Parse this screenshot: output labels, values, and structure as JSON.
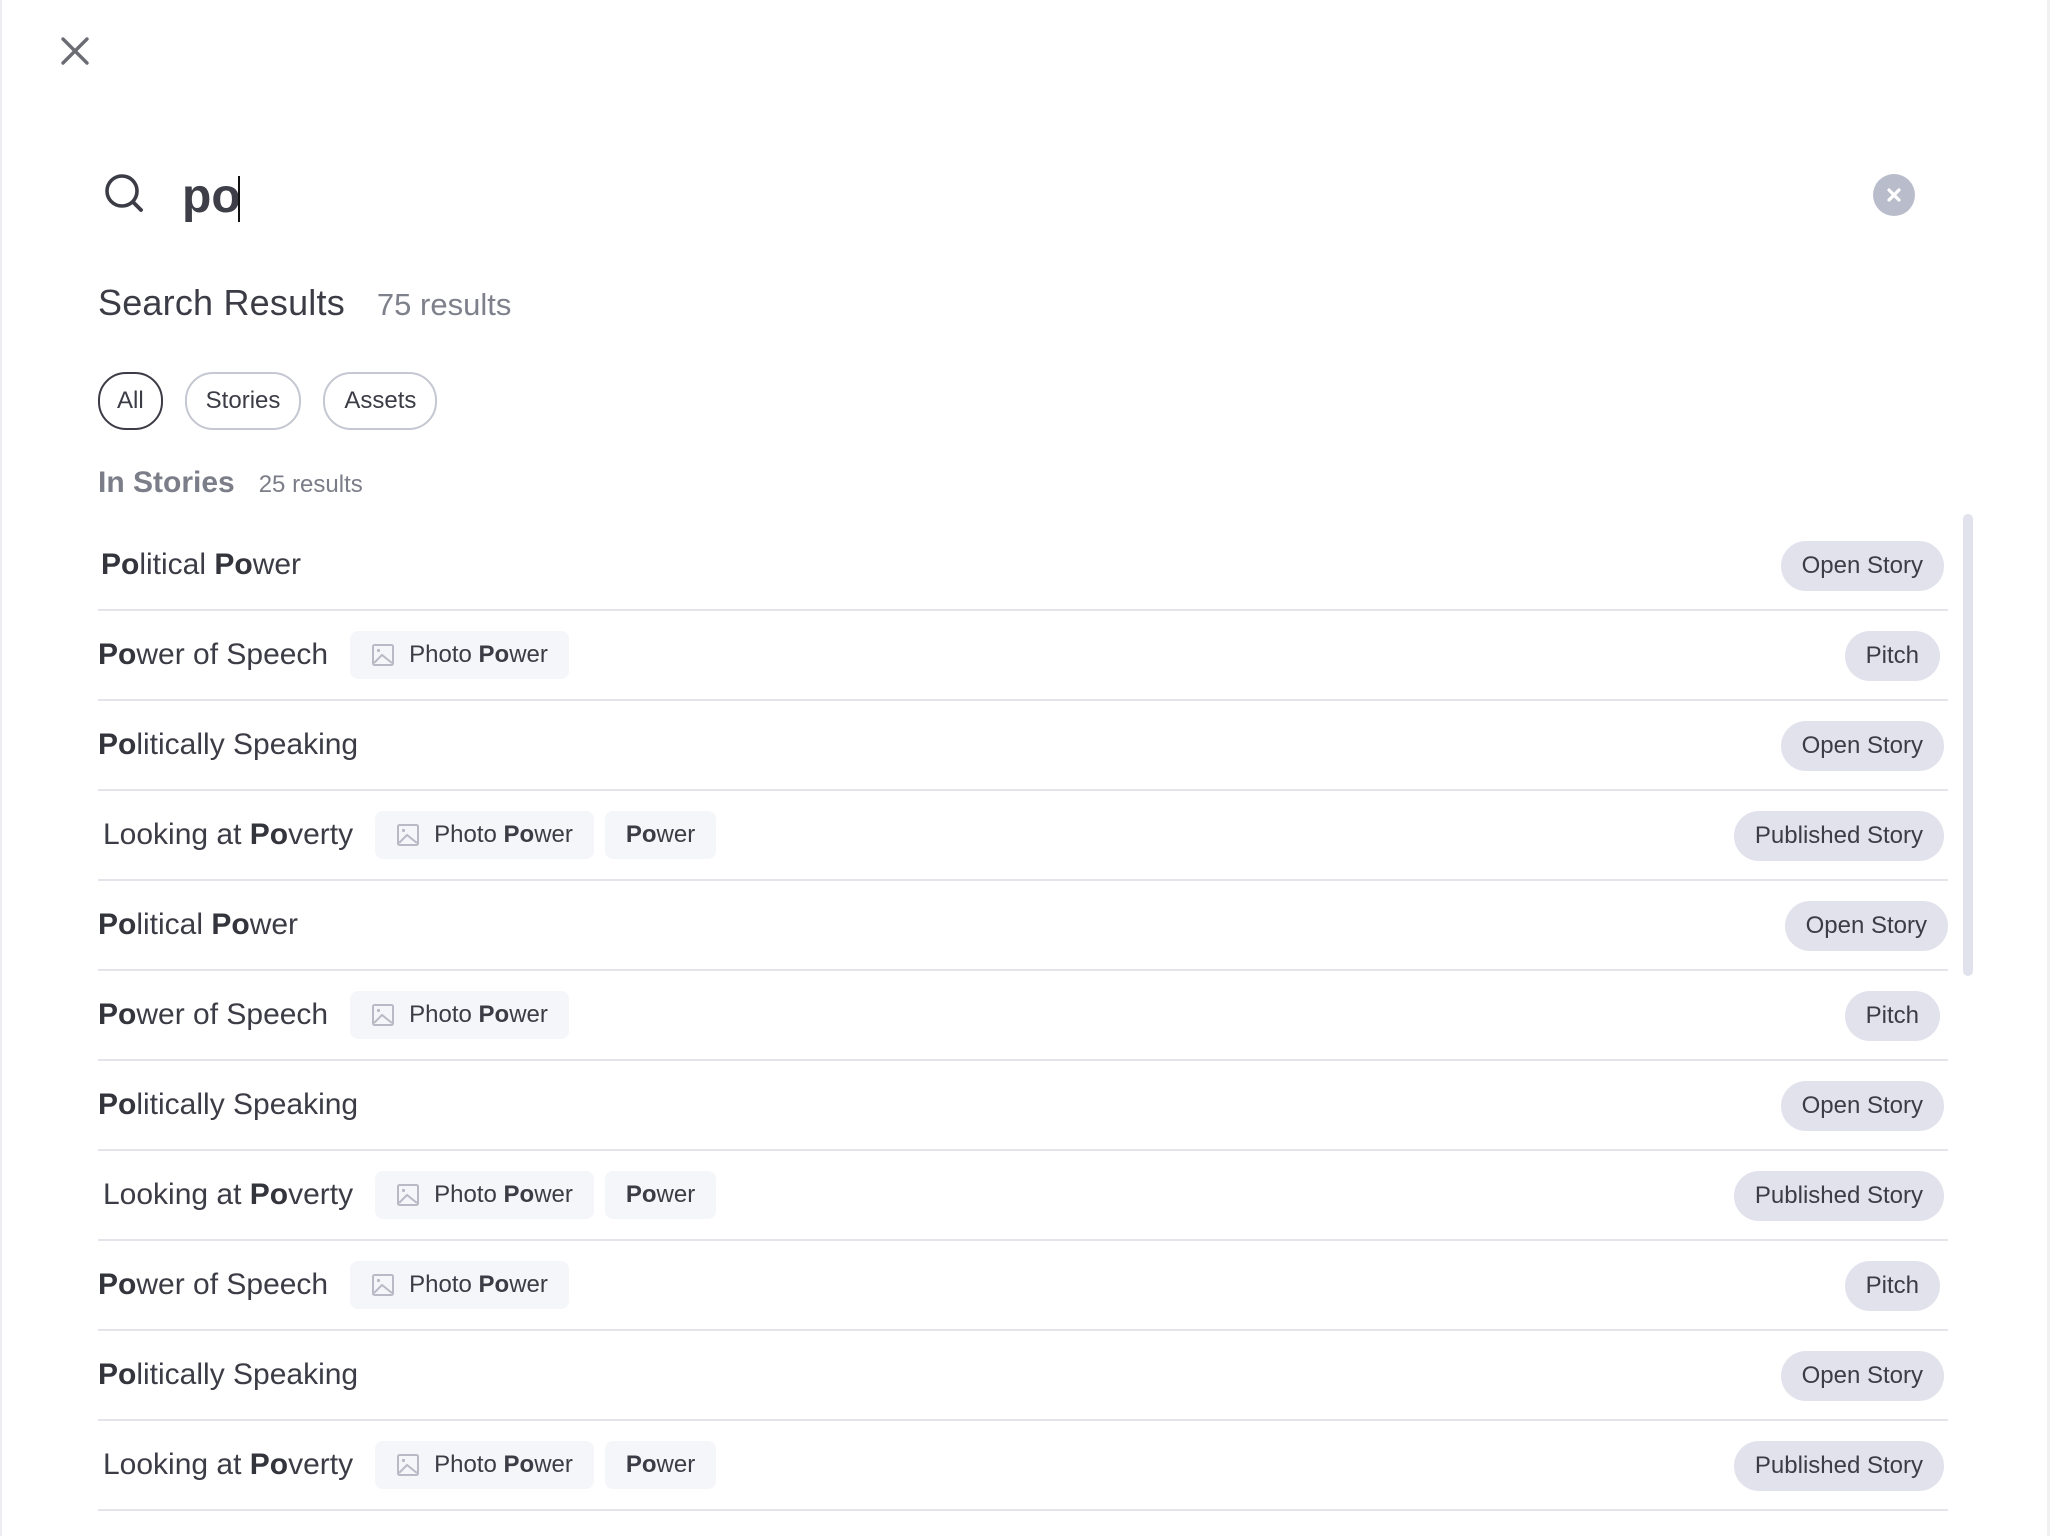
{
  "search": {
    "query": "po",
    "placeholder": ""
  },
  "icons": {
    "close": "close-icon",
    "search": "search-icon",
    "clear": "clear-circle-icon",
    "image": "image-icon"
  },
  "colors": {
    "text_primary": "#3b3c45",
    "text_muted": "#7e808b",
    "status_badge_bg": "#e1e2ec",
    "tag_bg": "#f5f6f9",
    "clear_button_bg": "#b9bdcb",
    "chip_border": "#c5c7d2"
  },
  "results": {
    "title": "Search Results",
    "count": "75 results"
  },
  "filters": [
    {
      "label": "All",
      "active": true
    },
    {
      "label": "Stories",
      "active": false
    },
    {
      "label": "Assets",
      "active": false
    }
  ],
  "section": {
    "title": "In Stories",
    "count": "25 results"
  },
  "rows": [
    {
      "title_parts": [
        [
          "Po",
          true
        ],
        [
          "litical ",
          false
        ],
        [
          "Po",
          true
        ],
        [
          "wer",
          false
        ]
      ],
      "tags": [],
      "status": "Open Story"
    },
    {
      "title_parts": [
        [
          "Po",
          true
        ],
        [
          "wer of Speech",
          false
        ]
      ],
      "tags": [
        {
          "icon": "image-icon",
          "parts": [
            [
              "Photo ",
              false
            ],
            [
              "Po",
              true
            ],
            [
              "wer",
              false
            ]
          ]
        }
      ],
      "status": "Pitch"
    },
    {
      "title_parts": [
        [
          "Po",
          true
        ],
        [
          "litically Speaking",
          false
        ]
      ],
      "tags": [],
      "status": "Open Story"
    },
    {
      "title_parts": [
        [
          "Looking at ",
          false
        ],
        [
          "Po",
          true
        ],
        [
          "verty",
          false
        ]
      ],
      "tags": [
        {
          "icon": "image-icon",
          "parts": [
            [
              "Photo ",
              false
            ],
            [
              "Po",
              true
            ],
            [
              "wer",
              false
            ]
          ]
        },
        {
          "icon": null,
          "parts": [
            [
              "Po",
              true
            ],
            [
              "wer",
              false
            ]
          ]
        }
      ],
      "status": "Published Story"
    },
    {
      "title_parts": [
        [
          "Po",
          true
        ],
        [
          "litical ",
          false
        ],
        [
          "Po",
          true
        ],
        [
          "wer",
          false
        ]
      ],
      "tags": [],
      "status": "Open Story"
    },
    {
      "title_parts": [
        [
          "Po",
          true
        ],
        [
          "wer of Speech",
          false
        ]
      ],
      "tags": [
        {
          "icon": "image-icon",
          "parts": [
            [
              "Photo ",
              false
            ],
            [
              "Po",
              true
            ],
            [
              "wer",
              false
            ]
          ]
        }
      ],
      "status": "Pitch"
    },
    {
      "title_parts": [
        [
          "Po",
          true
        ],
        [
          "litically Speaking",
          false
        ]
      ],
      "tags": [],
      "status": "Open Story"
    },
    {
      "title_parts": [
        [
          "Looking at ",
          false
        ],
        [
          "Po",
          true
        ],
        [
          "verty",
          false
        ]
      ],
      "tags": [
        {
          "icon": "image-icon",
          "parts": [
            [
              "Photo ",
              false
            ],
            [
              "Po",
              true
            ],
            [
              "wer",
              false
            ]
          ]
        },
        {
          "icon": null,
          "parts": [
            [
              "Po",
              true
            ],
            [
              "wer",
              false
            ]
          ]
        }
      ],
      "status": "Published Story"
    },
    {
      "title_parts": [
        [
          "Po",
          true
        ],
        [
          "wer of Speech",
          false
        ]
      ],
      "tags": [
        {
          "icon": "image-icon",
          "parts": [
            [
              "Photo ",
              false
            ],
            [
              "Po",
              true
            ],
            [
              "wer",
              false
            ]
          ]
        }
      ],
      "status": "Pitch"
    },
    {
      "title_parts": [
        [
          "Po",
          true
        ],
        [
          "litically Speaking",
          false
        ]
      ],
      "tags": [],
      "status": "Open Story"
    },
    {
      "title_parts": [
        [
          "Looking at ",
          false
        ],
        [
          "Po",
          true
        ],
        [
          "verty",
          false
        ]
      ],
      "tags": [
        {
          "icon": "image-icon",
          "parts": [
            [
              "Photo ",
              false
            ],
            [
              "Po",
              true
            ],
            [
              "wer",
              false
            ]
          ]
        },
        {
          "icon": null,
          "parts": [
            [
              "Po",
              true
            ],
            [
              "wer",
              false
            ]
          ]
        }
      ],
      "status": "Published Story"
    }
  ]
}
